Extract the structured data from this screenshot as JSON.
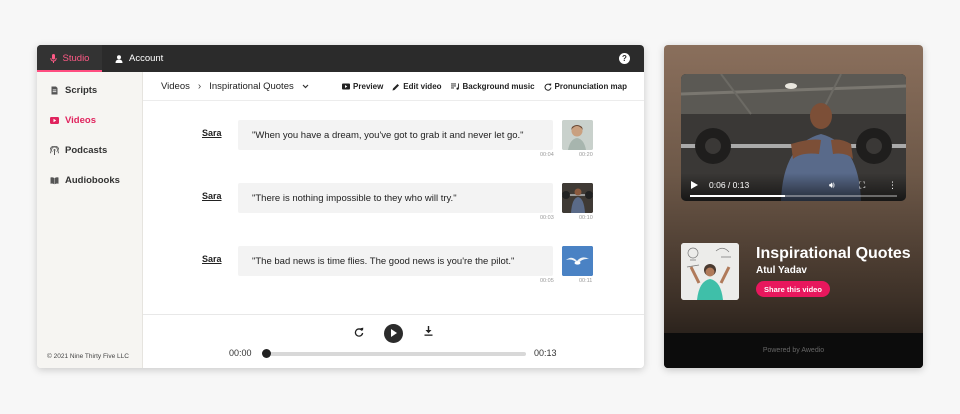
{
  "topbar": {
    "tabs": [
      {
        "label": "Studio",
        "icon": "microphone-icon",
        "active": true
      },
      {
        "label": "Account",
        "icon": "user-icon",
        "active": false
      }
    ],
    "help_icon": "help-icon"
  },
  "sidebar": {
    "items": [
      {
        "label": "Scripts",
        "icon": "document-icon",
        "active": false
      },
      {
        "label": "Videos",
        "icon": "video-icon",
        "active": true
      },
      {
        "label": "Podcasts",
        "icon": "podcast-icon",
        "active": false
      },
      {
        "label": "Audiobooks",
        "icon": "book-icon",
        "active": false
      }
    ],
    "footer": "© 2021 Nine Thirty Five LLC"
  },
  "breadcrumb": {
    "root": "Videos",
    "current": "Inspirational Quotes"
  },
  "toolbar": {
    "preview": "Preview",
    "edit_video": "Edit video",
    "background_music": "Background music",
    "pronunciation_map": "Pronunciation map"
  },
  "rows": [
    {
      "speaker": "Sara",
      "text": "\"When you have a dream, you've got to grab it and never let go.\"",
      "text_time": "00:04",
      "thumb_time": "00:20"
    },
    {
      "speaker": "Sara",
      "text": "\"There is nothing impossible to they who will try.\"",
      "text_time": "00:03",
      "thumb_time": "00:10"
    },
    {
      "speaker": "Sara",
      "text": "\"The bad news is time flies. The good news is you're the pilot.\"",
      "text_time": "00:05",
      "thumb_time": "00:11"
    }
  ],
  "player": {
    "current": "00:00",
    "total": "00:13",
    "progress": 0
  },
  "widget": {
    "video_time": "0:06 / 0:13",
    "video_progress": 0.46,
    "title": "Inspirational Quotes",
    "author": "Atul Yadav",
    "share": "Share this video",
    "footer": "Powered by Awedio"
  },
  "colors": {
    "accent": "#e8175d",
    "active_tab": "#ff5a86",
    "topbar": "#2b2b2b"
  }
}
